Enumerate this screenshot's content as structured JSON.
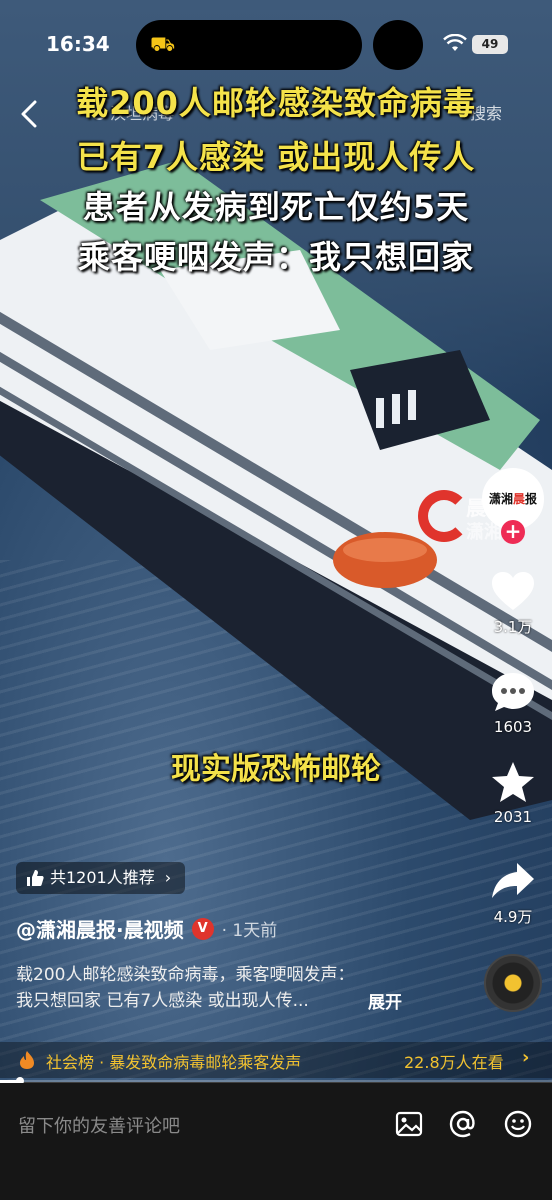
{
  "status_bar": {
    "time": "16:34",
    "battery": "49"
  },
  "nav": {
    "search_chip": "汉坦病毒",
    "search_button": "搜索"
  },
  "headline": {
    "line1": "载200人邮轮感染致命病毒",
    "line2": "已有7人感染 或出现人传人",
    "line3": "患者从发病到死亡仅约5天",
    "line4": "乘客哽咽发声：我只想回家"
  },
  "caption": "现实版恐怖邮轮",
  "watermark": {
    "line1": "晨",
    "line2": "潇湘"
  },
  "rail": {
    "avatar_label_a": "潇湘",
    "avatar_label_b": "晨",
    "avatar_label_c": "报",
    "follow": "+",
    "likes": "3.1万",
    "comments": "1603",
    "favorites": "2031",
    "shares": "4.9万"
  },
  "recommend": "共1201人推荐",
  "author": {
    "name": "@潇湘晨报·晨视频",
    "badge": "V",
    "time": "· 1天前"
  },
  "description": {
    "line1": "载200人邮轮感染致命病毒，乘客哽咽发声：",
    "line2": "我只想回家 已有7人感染 或出现人传...",
    "expand": "展开"
  },
  "trend": {
    "text": "社会榜 · 暴发致命病毒邮轮乘客发声",
    "count": "22.8万人在看"
  },
  "progress": {
    "fraction": 0.03
  },
  "comment_bar": {
    "placeholder": "留下你的友善评论吧"
  },
  "colors": {
    "accent_yellow": "#f4e24a",
    "brand_red": "#e0342c",
    "follow_pink": "#ee2c55",
    "trend_gold": "#f2c230"
  }
}
